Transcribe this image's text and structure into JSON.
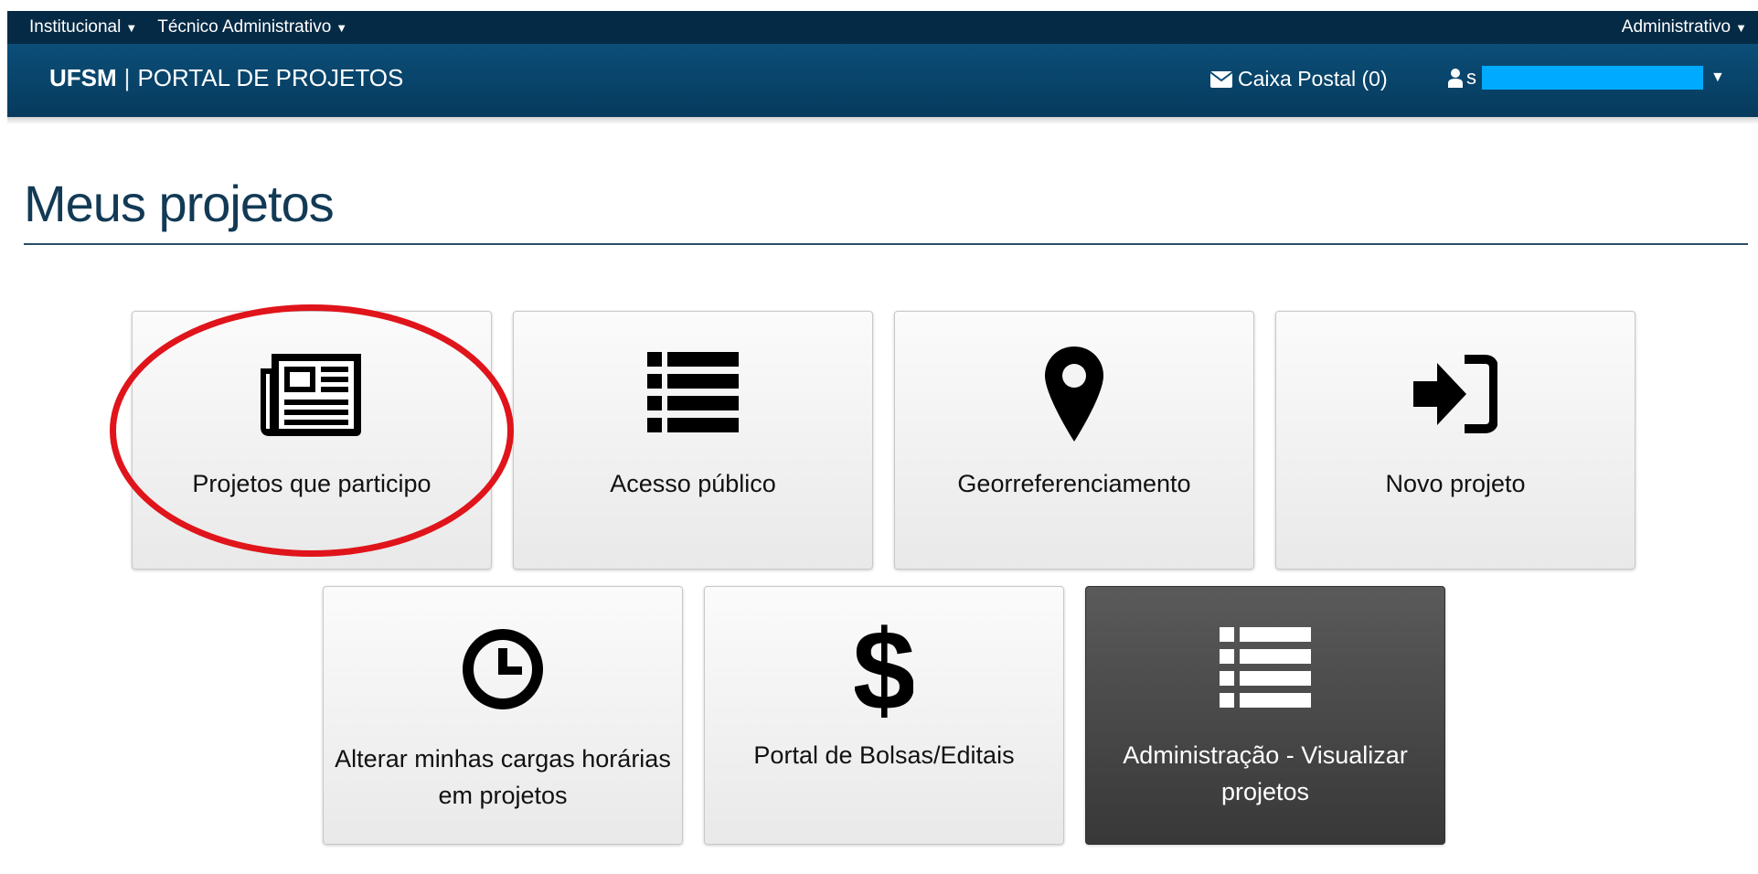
{
  "topbar": {
    "menu_institucional": "Institucional",
    "menu_tecnico": "Técnico Administrativo",
    "menu_administrativo": "Administrativo"
  },
  "header": {
    "brand_short": "UFSM",
    "brand_separator": "|",
    "brand_title": "PORTAL DE PROJETOS",
    "mailbox": "Caixa Postal (0)",
    "user_initial": "s"
  },
  "page": {
    "title": "Meus projetos"
  },
  "tiles": [
    {
      "label": "Projetos que participo",
      "icon": "newspaper-icon"
    },
    {
      "label": "Acesso público",
      "icon": "list-icon"
    },
    {
      "label": "Georreferenciamento",
      "icon": "map-marker-icon"
    },
    {
      "label": "Novo projeto",
      "icon": "sign-in-icon"
    },
    {
      "label": "Alterar minhas cargas horárias em projetos",
      "icon": "clock-icon"
    },
    {
      "label": "Portal de Bolsas/Editais",
      "icon": "dollar-icon"
    },
    {
      "label": "Administração - Visualizar projetos",
      "icon": "list-icon"
    }
  ],
  "colors": {
    "topbar": "#052a45",
    "header": "#0b4e78",
    "highlight": "#e0141b",
    "redaction": "#00aaff",
    "dark_tile": "#474747"
  }
}
